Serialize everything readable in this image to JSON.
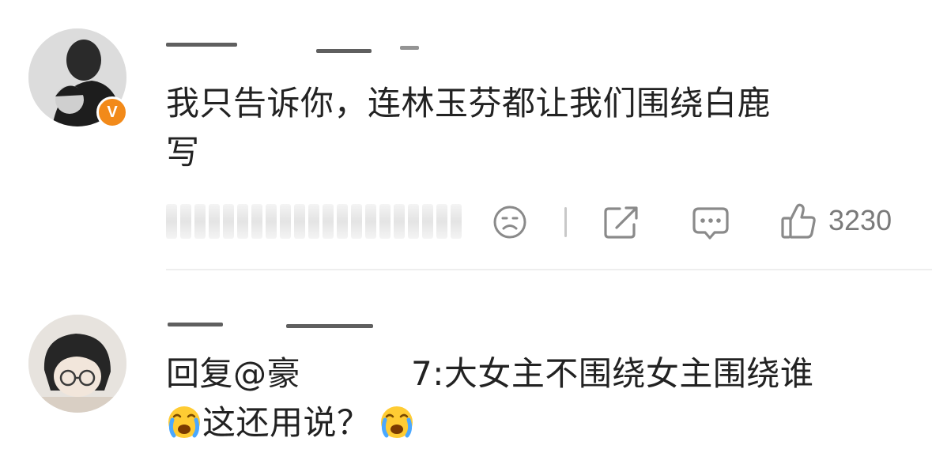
{
  "comment": {
    "text_line1": "我只告诉你，连林玉芬都让我们围绕白鹿",
    "text_line2": "写",
    "avatar_icon": "user-avatar",
    "verified_badge": "V",
    "actions": {
      "dislike_icon": "frown-face-icon",
      "share_icon": "share-icon",
      "reply_icon": "comment-bubble-icon",
      "like_icon": "thumb-up-icon",
      "like_count": "3230"
    }
  },
  "reply": {
    "avatar_icon": "user-avatar",
    "prefix": "回复@",
    "mention_visible_start": "豪",
    "mention_visible_end": "7",
    "separator": ":",
    "text_line1_after": "大女主不围绕女主围绕谁",
    "emoji_name": "crying-face-emoji",
    "text_line2": "这还用说？"
  },
  "colors": {
    "badge": "#f28a1a",
    "icon_gray": "#8a8a8a",
    "text": "#222222",
    "divider": "#eeeeee"
  }
}
